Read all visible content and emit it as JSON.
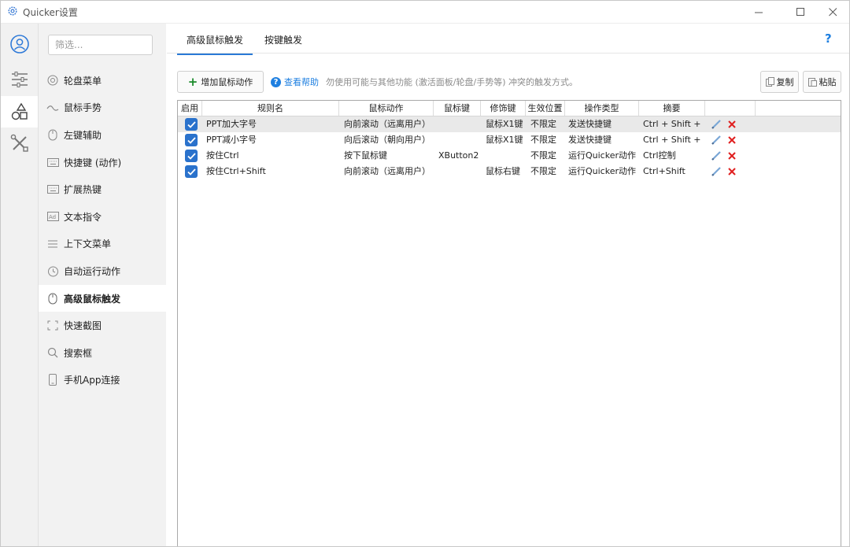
{
  "window": {
    "title": "Quicker设置"
  },
  "rail": {
    "icons": [
      "user-icon",
      "sliders-icon",
      "shapes-icon",
      "tools-icon"
    ]
  },
  "sidebar": {
    "filter_placeholder": "筛选...",
    "items": [
      {
        "label": "轮盘菜单",
        "icon": "wheel-icon"
      },
      {
        "label": "鼠标手势",
        "icon": "gesture-icon"
      },
      {
        "label": "左键辅助",
        "icon": "mouse-icon"
      },
      {
        "label": "快捷键 (动作)",
        "icon": "keyboard-icon"
      },
      {
        "label": "扩展热键",
        "icon": "keyboard-icon"
      },
      {
        "label": "文本指令",
        "icon": "text-icon"
      },
      {
        "label": "上下文菜单",
        "icon": "menu-icon"
      },
      {
        "label": "自动运行动作",
        "icon": "clock-icon"
      },
      {
        "label": "高级鼠标触发",
        "icon": "mouse-icon",
        "active": true
      },
      {
        "label": "快速截图",
        "icon": "screenshot-icon"
      },
      {
        "label": "搜索框",
        "icon": "search-icon"
      },
      {
        "label": "手机App连接",
        "icon": "phone-icon"
      }
    ]
  },
  "tabs": [
    {
      "label": "高级鼠标触发",
      "active": true
    },
    {
      "label": "按键触发",
      "active": false
    }
  ],
  "toolbar": {
    "add_label": "增加鼠标动作",
    "help_label": "查看帮助",
    "hint": "勿使用可能与其他功能 (激活面板/轮盘/手势等) 冲突的触发方式。",
    "copy_label": "复制",
    "paste_label": "粘贴"
  },
  "table": {
    "columns": [
      "启用",
      "规则名",
      "鼠标动作",
      "鼠标键",
      "修饰键",
      "生效位置",
      "操作类型",
      "摘要"
    ],
    "rows": [
      {
        "enabled": true,
        "name": "PPT加大字号",
        "action": "向前滚动（远离用户）",
        "button": "",
        "modifier": "鼠标X1键",
        "scope": "不限定",
        "op": "发送快捷键",
        "summary": "Ctrl + Shift + ."
      },
      {
        "enabled": true,
        "name": "PPT减小字号",
        "action": "向后滚动（朝向用户）",
        "button": "",
        "modifier": "鼠标X1键",
        "scope": "不限定",
        "op": "发送快捷键",
        "summary": "Ctrl + Shift + ,"
      },
      {
        "enabled": true,
        "name": "按住Ctrl",
        "action": "按下鼠标键",
        "button": "XButton2",
        "modifier": "",
        "scope": "不限定",
        "op": "运行Quicker动作",
        "summary": "Ctrl控制"
      },
      {
        "enabled": true,
        "name": "按住Ctrl+Shift",
        "action": "向前滚动（远离用户）",
        "button": "",
        "modifier": "鼠标右键",
        "scope": "不限定",
        "op": "运行Quicker动作",
        "summary": "Ctrl+Shift"
      }
    ]
  },
  "colors": {
    "accent": "#2a72cc",
    "link": "#1e7fe0",
    "delete": "#e02020",
    "add": "#1a8a2a"
  }
}
